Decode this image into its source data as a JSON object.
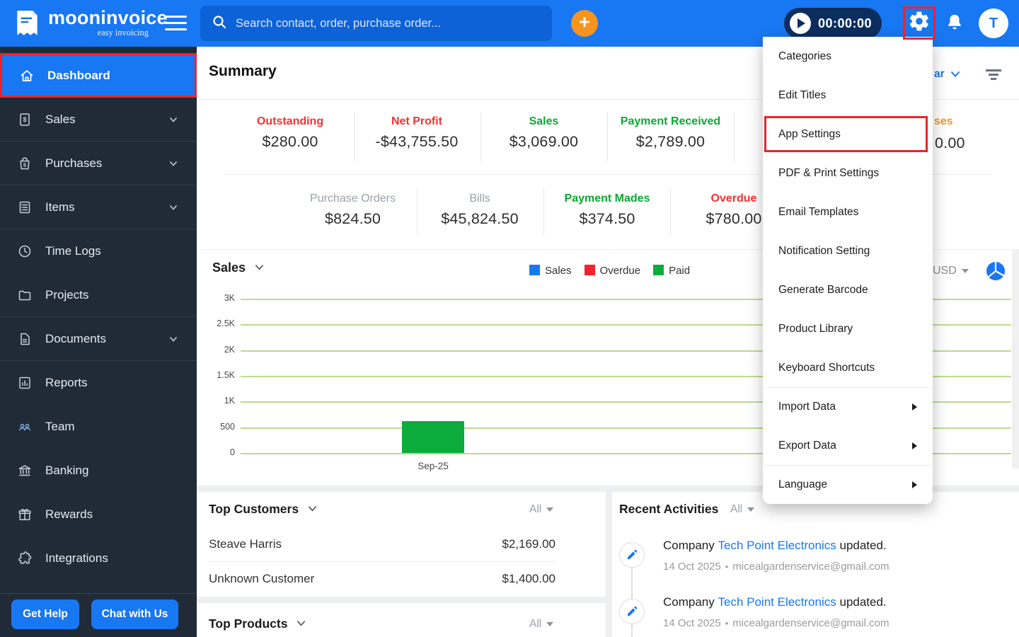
{
  "topbar": {
    "brand": "mooninvoice",
    "tagline": "easy invoicing",
    "search_placeholder": "Search contact, order, purchase order...",
    "timer": "00:00:00",
    "avatar_initial": "T"
  },
  "sidebar": {
    "items": [
      {
        "label": "Dashboard",
        "active": true
      },
      {
        "label": "Sales",
        "expandable": true
      },
      {
        "label": "Purchases",
        "expandable": true
      },
      {
        "label": "Items",
        "expandable": true
      },
      {
        "label": "Time Logs"
      },
      {
        "label": "Projects"
      },
      {
        "label": "Documents",
        "expandable": true
      },
      {
        "label": "Reports"
      },
      {
        "label": "Team"
      },
      {
        "label": "Banking"
      },
      {
        "label": "Rewards"
      },
      {
        "label": "Integrations"
      }
    ],
    "get_help": "Get Help",
    "chat_with_us": "Chat with Us"
  },
  "summary": {
    "title": "Summary",
    "period_fragment": "ar",
    "row1": [
      {
        "label": "Outstanding",
        "value": "$280.00",
        "color": "#F73131"
      },
      {
        "label": "Net Profit",
        "value": "-$43,755.50",
        "color": "#F73131"
      },
      {
        "label": "Sales",
        "value": "$3,069.00",
        "color": "#0BA834"
      },
      {
        "label": "Payment Received",
        "value": "$2,789.00",
        "color": "#0BA834"
      }
    ],
    "partial_column": {
      "label_fragment": "ses",
      "value_fragment": "0.00",
      "color": "#F7941E"
    },
    "row2": [
      {
        "label": "Purchase Orders",
        "value": "$824.50",
        "color": "#9AA1A9"
      },
      {
        "label": "Bills",
        "value": "$45,824.50",
        "color": "#9AA1A9"
      },
      {
        "label": "Payment Mades",
        "value": "$374.50",
        "color": "#0BA834"
      },
      {
        "label": "Overdue",
        "value": "$780.00",
        "color": "#F73131"
      }
    ]
  },
  "chart": {
    "title": "Sales",
    "currency": "USD"
  },
  "chart_data": {
    "type": "bar",
    "title": "Sales",
    "categories": [
      "Sep-25"
    ],
    "series": [
      {
        "name": "Sales",
        "color": "#1877F2",
        "values": [
          0
        ]
      },
      {
        "name": "Overdue",
        "color": "#F5222D",
        "values": [
          0
        ]
      },
      {
        "name": "Paid",
        "color": "#0CAC3C",
        "values": [
          620
        ]
      }
    ],
    "legend": [
      "Sales",
      "Overdue",
      "Paid"
    ],
    "legend_position": "top",
    "ylim": [
      0,
      3000
    ],
    "yticks": [
      "0",
      "500",
      "1K",
      "1.5K",
      "2K",
      "2.5K",
      "3K"
    ],
    "grid": true
  },
  "top_customers": {
    "title": "Top Customers",
    "filter": "All",
    "rows": [
      {
        "name": "Steave Harris",
        "amount": "$2,169.00"
      },
      {
        "name": "Unknown Customer",
        "amount": "$1,400.00"
      }
    ]
  },
  "top_products": {
    "title": "Top Products",
    "filter": "All"
  },
  "recent_activities": {
    "title": "Recent Activities",
    "filter": "All",
    "items": [
      {
        "prefix": "Company",
        "company": "Tech Point Electronics",
        "suffix": "updated.",
        "date": "14 Oct 2025",
        "email": "micealgardenservice@gmail.com"
      },
      {
        "prefix": "Company",
        "company": "Tech Point Electronics",
        "suffix": "updated.",
        "date": "14 Oct 2025",
        "email": "micealgardenservice@gmail.com"
      }
    ]
  },
  "settings_menu": {
    "items": [
      {
        "label": "Categories"
      },
      {
        "label": "Edit Titles"
      },
      {
        "label": "App Settings",
        "highlighted": true
      },
      {
        "label": "PDF & Print Settings"
      },
      {
        "label": "Email Templates"
      },
      {
        "label": "Notification Setting"
      },
      {
        "label": "Generate Barcode"
      },
      {
        "label": "Product Library"
      },
      {
        "label": "Keyboard Shortcuts"
      },
      {
        "label": "Import Data",
        "submenu": true
      },
      {
        "label": "Export Data",
        "submenu": true
      },
      {
        "label": "Language",
        "submenu": true
      }
    ]
  },
  "colors": {
    "accent": "#1877F2",
    "sidebar": "#212B38",
    "orange": "#F7941E",
    "negative_red": "#F73131",
    "positive_green": "#0BA834",
    "annotation_red": "#E8252A",
    "bar_green": "#0CAC3C",
    "timer_navy": "#0C2E5E",
    "gridline": "#BCDB8F"
  }
}
